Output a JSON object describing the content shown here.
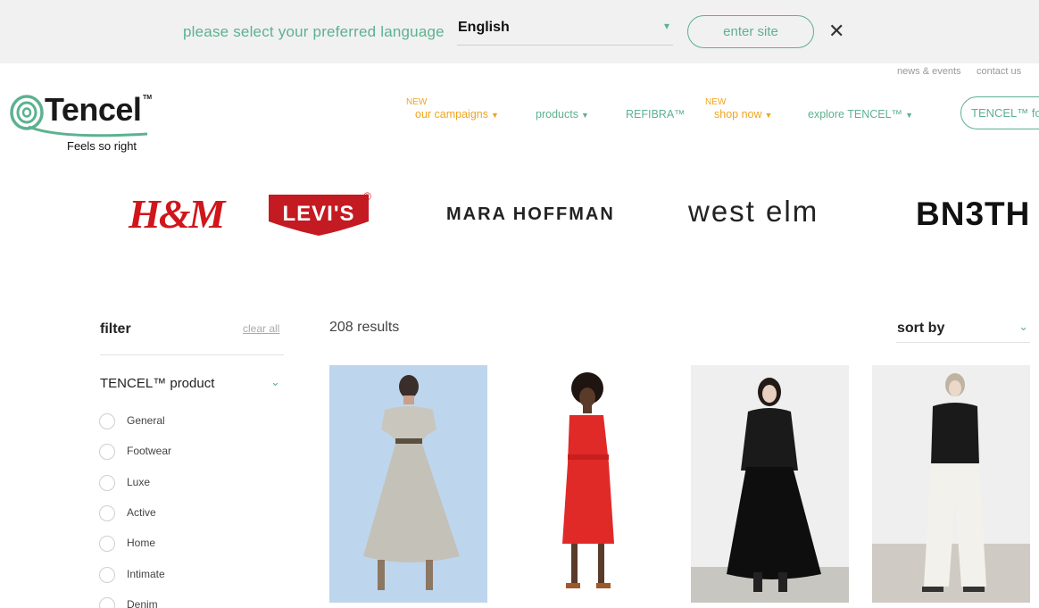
{
  "language_bar": {
    "prompt": "please select your preferred language",
    "selected_language": "English",
    "enter_label": "enter site"
  },
  "utility_links": [
    "news & events",
    "contact us"
  ],
  "logo": {
    "word": "Tencel",
    "tm": "TM",
    "tagline": "Feels so right"
  },
  "nav": {
    "new_badge": "NEW",
    "items": [
      "our campaigns",
      "products",
      "REFIBRA™",
      "shop now",
      "explore TENCEL™"
    ],
    "tencel_for": "TENCEL™ for"
  },
  "brands": [
    "H&M",
    "LEVI'S",
    "®",
    "MARA HOFFMAN",
    "west elm",
    "BN3TH"
  ],
  "filter": {
    "title": "filter",
    "clear_all": "clear all",
    "facet": "TENCEL™ product",
    "options": [
      "General",
      "Footwear",
      "Luxe",
      "Active",
      "Home",
      "Intimate",
      "Denim"
    ]
  },
  "results": {
    "text": "208 results",
    "sort_label": "sort by"
  },
  "products": [
    {
      "desc": "grey midi dress on light blue background"
    },
    {
      "desc": "red tie-waist dress"
    },
    {
      "desc": "black sheer top and black maxi skirt"
    },
    {
      "desc": "black sheer top and white trousers"
    }
  ],
  "colors": {
    "accent": "#5db190",
    "orange": "#f0a51e",
    "hm_red": "#d0161b",
    "levis_red": "#c41a22"
  },
  "icons": [
    "close-icon",
    "chevron-down-icon",
    "radio-icon",
    "tencel-logo-icon"
  ]
}
